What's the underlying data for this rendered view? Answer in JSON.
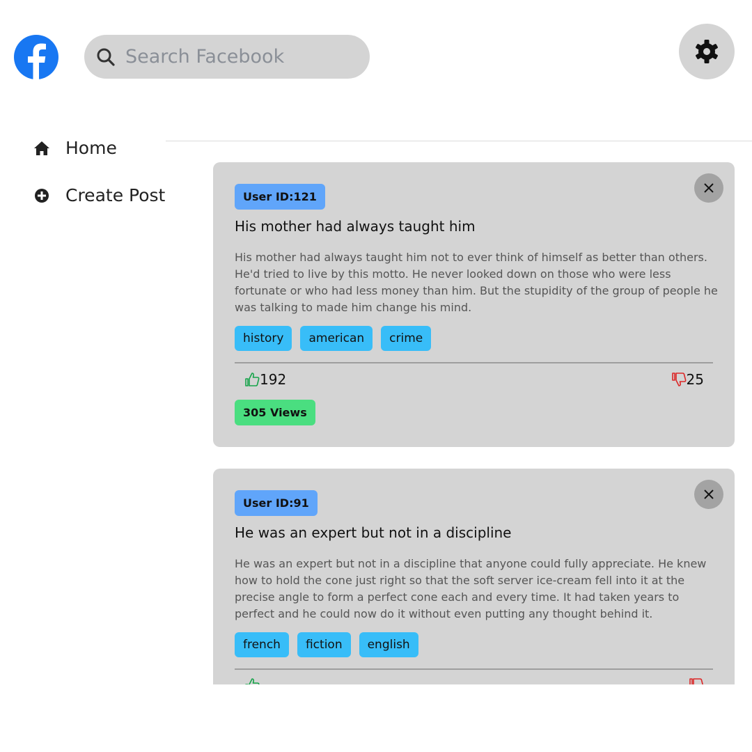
{
  "header": {
    "logo_icon": "facebook-logo",
    "search_placeholder": "Search Facebook",
    "settings_icon": "gear-icon"
  },
  "sidebar": {
    "items": [
      {
        "label": "Home",
        "icon": "home-icon"
      },
      {
        "label": "Create Post",
        "icon": "plus-circle-icon"
      }
    ]
  },
  "posts": [
    {
      "user": "User ID:121",
      "title": "His mother had always taught him",
      "body": "His mother had always taught him not to ever think of himself as better than others. He'd tried to live by this motto. He never looked down on those who were less fortunate or who had less money than him. But the stupidity of the group of people he was talking to made him change his mind.",
      "tags": [
        "history",
        "american",
        "crime"
      ],
      "likes": "192",
      "dislikes": "25",
      "views": "305 Views"
    },
    {
      "user": "User ID:91",
      "title": "He was an expert but not in a discipline",
      "body": "He was an expert but not in a discipline that anyone could fully appreciate. He knew how to hold the cone just right so that the soft server ice-cream fell into it at the precise angle to form a perfect cone each and every time. It had taken years to perfect and he could now do it without even putting any thought behind it.",
      "tags": [
        "french",
        "fiction",
        "english"
      ]
    }
  ],
  "colors": {
    "facebook_blue": "#1877f2",
    "card_bg": "#d4d4d4",
    "user_badge": "#60a5fa",
    "tag_bg": "#38bdf8",
    "views_badge": "#4ade80",
    "like_green": "#16a34a",
    "dislike_red": "#dc2626"
  }
}
